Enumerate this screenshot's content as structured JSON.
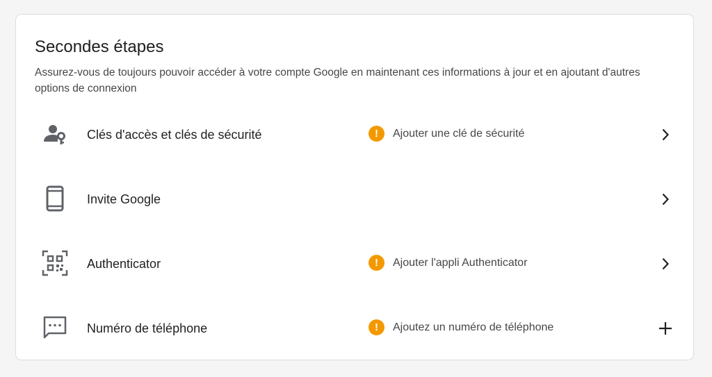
{
  "section": {
    "title": "Secondes étapes",
    "description": "Assurez-vous de toujours pouvoir accéder à votre compte Google en maintenant ces informations à jour et en ajoutant d'autres options de connexion"
  },
  "rows": [
    {
      "label": "Clés d'accès et clés de sécurité",
      "status": "Ajouter une clé de sécurité",
      "icon": "person-key-icon",
      "action": "chevron-right-icon"
    },
    {
      "label": "Invite Google",
      "status": "",
      "icon": "phone-icon",
      "action": "chevron-right-icon"
    },
    {
      "label": "Authenticator",
      "status": "Ajouter l'appli Authenticator",
      "icon": "qr-code-icon",
      "action": "chevron-right-icon"
    },
    {
      "label": "Numéro de téléphone",
      "status": "Ajoutez un numéro de téléphone",
      "icon": "sms-icon",
      "action": "plus-icon"
    }
  ],
  "warning_symbol": "!",
  "colors": {
    "warning": "#f29900",
    "icon": "#5f6368",
    "text": "#1f1f1f",
    "secondary_text": "#444746"
  }
}
